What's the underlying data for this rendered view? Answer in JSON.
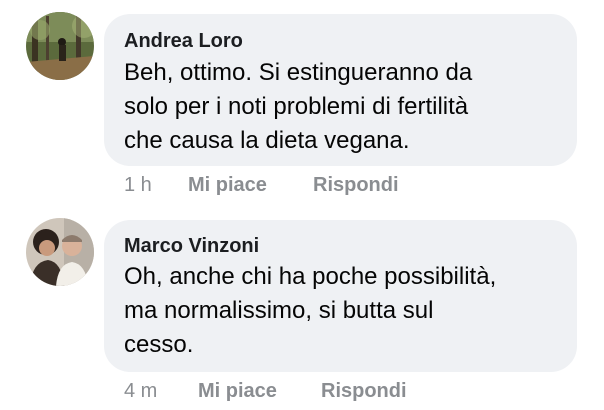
{
  "comments": [
    {
      "author": "Andrea Loro",
      "lines": [
        "Beh, ottimo. Si estingueranno da",
        "solo per i noti problemi di fertilità",
        "che causa la dieta vegana."
      ],
      "time": "1 h",
      "like_label": "Mi piace",
      "reply_label": "Rispondi"
    },
    {
      "author": "Marco Vinzoni",
      "lines": [
        "Oh, anche chi ha poche possibilità,",
        "ma normalissimo, si butta sul",
        "cesso."
      ],
      "time": "4 m",
      "like_label": "Mi piace",
      "reply_label": "Rispondi"
    }
  ],
  "colors": {
    "bubble": "#eff1f4",
    "meta_text": "#8a8d91",
    "body_text": "#050505"
  }
}
